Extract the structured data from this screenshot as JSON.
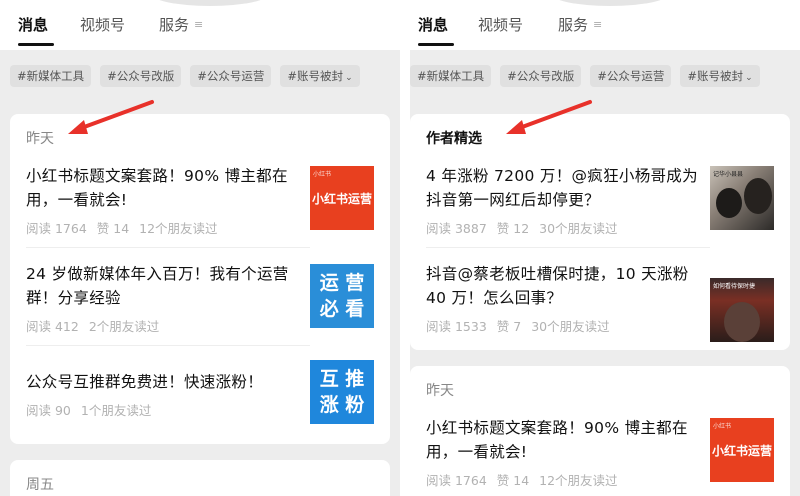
{
  "colors": {
    "accent_arrow": "#e8312a",
    "thumb_red": "#e8401f",
    "thumb_blue": "#2a8ed8"
  },
  "left": {
    "tabs": [
      {
        "label": "消息"
      },
      {
        "label": "视频号"
      },
      {
        "label": "服务"
      }
    ],
    "menu_icon": "≡",
    "tags": [
      "#新媒体工具",
      "#公众号改版",
      "#公众号运营",
      "#账号被封"
    ],
    "card1": {
      "header": "昨天",
      "items": [
        {
          "title": "小红书标题文案套路！90% 博主都在用，一看就会!",
          "read": "阅读 1764",
          "likes": "赞 14",
          "friends": "12个朋友读过",
          "thumb_text": "小红书运营",
          "thumb_small": "小红书"
        },
        {
          "title": "24 岁做新媒体年入百万！我有个运营群！分享经验",
          "read": "阅读 412",
          "likes": "",
          "friends": "2个朋友读过",
          "thumb_line1": "运 营",
          "thumb_line2": "必 看"
        },
        {
          "title": "公众号互推群免费进！快速涨粉！",
          "read": "阅读 90",
          "likes": "",
          "friends": "1个朋友读过",
          "thumb_line1": "互 推",
          "thumb_line2": "涨 粉"
        }
      ]
    },
    "card2": {
      "header": "周五"
    }
  },
  "right": {
    "tabs": [
      {
        "label": "消息"
      },
      {
        "label": "视频号"
      },
      {
        "label": "服务"
      }
    ],
    "menu_icon": "≡",
    "tags": [
      "#新媒体工具",
      "#公众号改版",
      "#公众号运营",
      "#账号被封"
    ],
    "card1": {
      "header": "作者精选",
      "items": [
        {
          "title": "4 年涨粉 7200 万！@疯狂小杨哥成为抖音第一网红后却停更？",
          "read": "阅读 3887",
          "likes": "赞 12",
          "friends": "30个朋友读过",
          "thumb_caption": "记华小县县"
        },
        {
          "title": "抖音@蔡老板吐槽保时捷，10 天涨粉 40 万！怎么回事？",
          "read": "阅读 1533",
          "likes": "赞 7",
          "friends": "30个朋友读过",
          "thumb_caption": "如何看待保时捷"
        }
      ]
    },
    "card2": {
      "header": "昨天",
      "items": [
        {
          "title": "小红书标题文案套路！90% 博主都在用，一看就会!",
          "read": "阅读 1764",
          "likes": "赞 14",
          "friends": "12个朋友读过",
          "thumb_text": "小红书运营",
          "thumb_small": "小红书"
        }
      ]
    }
  }
}
